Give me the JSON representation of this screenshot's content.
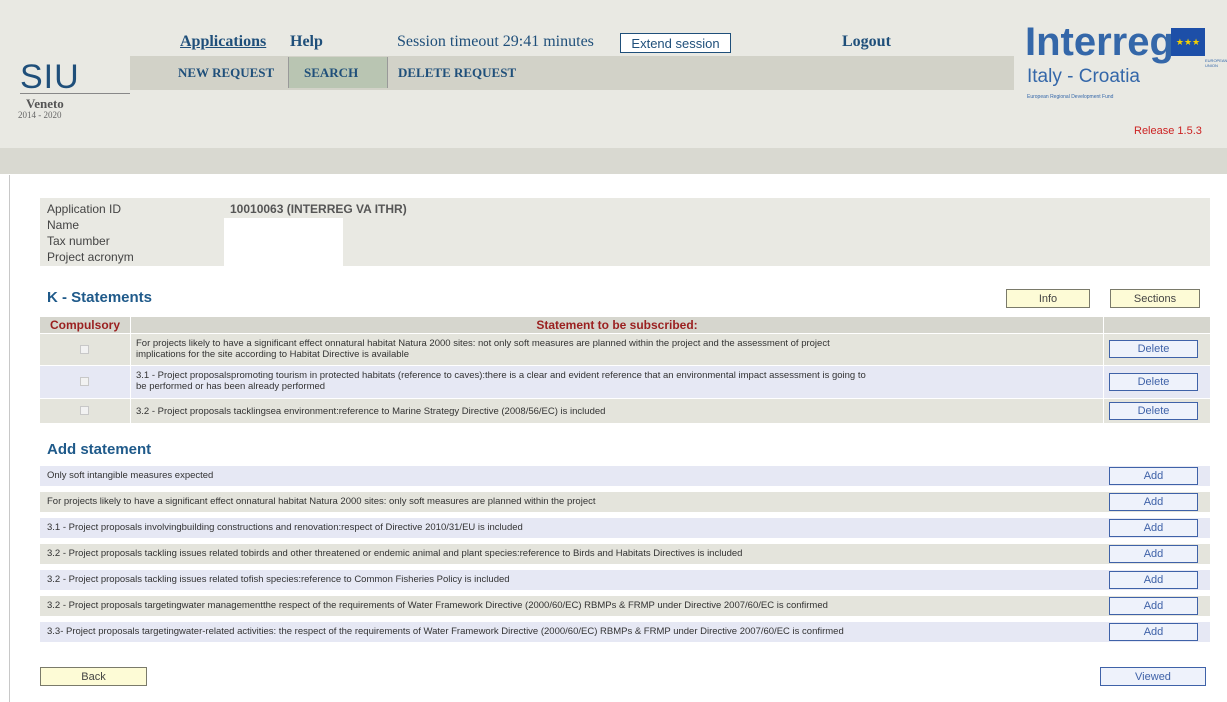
{
  "header": {
    "logo_siu": "SIU",
    "logo_region": "Veneto",
    "logo_years": "2014 - 2020",
    "nav_top": {
      "applications": "Applications",
      "help": "Help",
      "session": "Session timeout 29:41 minutes",
      "extend": "Extend session",
      "logout": "Logout"
    },
    "nav_sub": {
      "new_request": "NEW REQUEST",
      "search": "SEARCH",
      "delete_request": "DELETE REQUEST"
    },
    "brand": "Interreg",
    "program": "Italy - Croatia",
    "fund": "European Regional Development Fund",
    "eu_label": "EUROPEAN UNION",
    "release": "Release 1.5.3"
  },
  "application": {
    "labels": [
      "Application ID",
      "Name",
      "Tax number",
      "Project acronym"
    ],
    "id_value": "10010063 (INTERREG VA ITHR)"
  },
  "statements": {
    "title": "K - Statements",
    "info_btn": "Info",
    "sections_btn": "Sections",
    "col_compulsory": "Compulsory",
    "col_statement": "Statement to be subscribed:",
    "rows": [
      {
        "text1": "For projects likely to have a significant effect onnatural habitat Natura 2000 sites: not only soft measures are planned within the project and the assessment of project",
        "text2": "implications for the site according to Habitat Directive is available",
        "action": "Delete"
      },
      {
        "text1": "3.1 - Project proposalspromoting tourism in protected habitats (reference to caves):there is a clear and evident reference that an environmental impact assessment is going to",
        "text2": "be performed or has been already performed",
        "action": "Delete"
      },
      {
        "text1": "3.2 - Project proposals tacklingsea environment:reference to Marine Strategy Directive (2008/56/EC) is included",
        "text2": "",
        "action": "Delete"
      }
    ]
  },
  "add_statement": {
    "title": "Add statement",
    "rows": [
      {
        "text": "Only soft intangible measures expected",
        "action": "Add"
      },
      {
        "text": "For projects likely to have a significant effect onnatural habitat Natura 2000 sites: only soft measures are planned within the project",
        "action": "Add"
      },
      {
        "text": "3.1 - Project proposals involvingbuilding constructions and renovation:respect of Directive 2010/31/EU is included",
        "action": "Add"
      },
      {
        "text": "3.2 - Project proposals tackling issues related tobirds and other threatened or endemic animal and plant species:reference to Birds and Habitats Directives is included",
        "action": "Add"
      },
      {
        "text": "3.2 - Project proposals tackling issues related tofish species:reference to Common Fisheries Policy is included",
        "action": "Add"
      },
      {
        "text": "3.2 - Project proposals targetingwater managementthe respect of the requirements of Water Framework Directive (2000/60/EC) RBMPs & FRMP under Directive 2007/60/EC is confirmed",
        "action": "Add"
      },
      {
        "text": "3.3- Project proposals targetingwater-related activities: the respect of the requirements of Water Framework Directive (2000/60/EC) RBMPs & FRMP under Directive 2007/60/EC is confirmed",
        "action": "Add"
      }
    ]
  },
  "footer": {
    "back": "Back",
    "viewed": "Viewed"
  },
  "colors": {
    "header_bg": "#e9e9e3",
    "nav_blue": "#1f4f7a",
    "brand_blue": "#3467a9",
    "table_header_text": "#9a1f1f",
    "release_red": "#cc2222"
  }
}
